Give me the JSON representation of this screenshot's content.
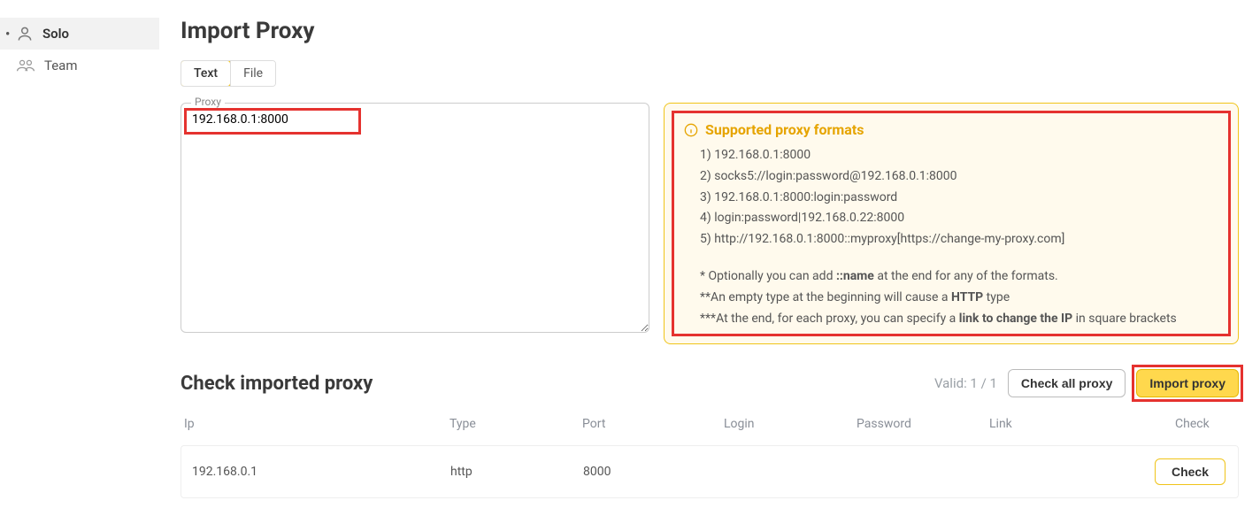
{
  "sidebar": {
    "items": [
      {
        "label": "Solo",
        "active": true
      },
      {
        "label": "Team",
        "active": false
      }
    ]
  },
  "page": {
    "title": "Import Proxy"
  },
  "tabs": {
    "text": "Text",
    "file": "File",
    "active": "text"
  },
  "proxy": {
    "label": "Proxy",
    "value": "192.168.0.1:8000"
  },
  "info": {
    "title": "Supported proxy formats",
    "formats": [
      "1) 192.168.0.1:8000",
      "2) socks5://login:password@192.168.0.1:8000",
      "3) 192.168.0.1:8000:login:password",
      "4) login:password|192.168.0.22:8000",
      "5) http://192.168.0.1:8000::myproxy[https://change-my-proxy.com]"
    ],
    "note1_pre": "* Optionally you can add ",
    "note1_bold": "::name",
    "note1_post": " at the end for any of the formats.",
    "note2_pre": "**An empty type at the beginning will cause a ",
    "note2_bold": "HTTP",
    "note2_post": " type",
    "note3_pre": "***At the end, for each proxy, you can specify a ",
    "note3_bold": "link to change the IP",
    "note3_post": " in square brackets"
  },
  "check": {
    "title": "Check imported proxy",
    "valid_label": "Valid: 1 / 1",
    "check_all_label": "Check all proxy",
    "import_label": "Import proxy",
    "columns": {
      "ip": "Ip",
      "type": "Type",
      "port": "Port",
      "login": "Login",
      "password": "Password",
      "link": "Link",
      "check": "Check"
    },
    "rows": [
      {
        "ip": "192.168.0.1",
        "type": "http",
        "port": "8000",
        "login": "",
        "password": "",
        "link": "",
        "check_label": "Check"
      }
    ]
  }
}
